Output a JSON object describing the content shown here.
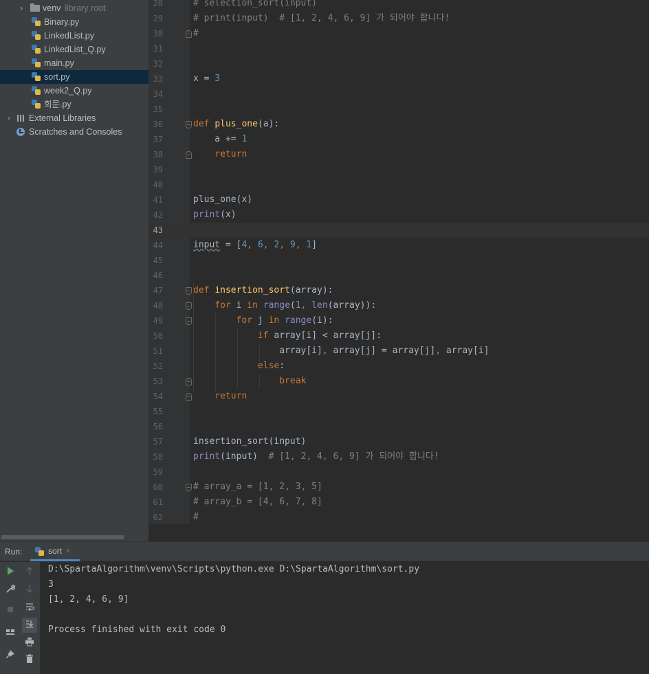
{
  "project_tree": {
    "items": [
      {
        "label": "venv",
        "hint": "library root",
        "icon": "folder-icon",
        "indent": 2,
        "expander": "›"
      },
      {
        "label": "Binary.py",
        "icon": "python-file-icon",
        "indent": 3
      },
      {
        "label": "LinkedList.py",
        "icon": "python-file-icon",
        "indent": 3
      },
      {
        "label": "LinkedList_Q.py",
        "icon": "python-file-icon",
        "indent": 3
      },
      {
        "label": "main.py",
        "icon": "python-file-icon",
        "indent": 3
      },
      {
        "label": "sort.py",
        "icon": "python-file-icon",
        "indent": 3,
        "selected": true
      },
      {
        "label": "week2_Q.py",
        "icon": "python-file-icon",
        "indent": 3
      },
      {
        "label": "회문.py",
        "icon": "python-file-icon",
        "indent": 3
      },
      {
        "label": "External Libraries",
        "icon": "library-icon",
        "indent": 1,
        "expander": "›"
      },
      {
        "label": "Scratches and Consoles",
        "icon": "scratch-icon",
        "indent": 1
      }
    ]
  },
  "editor": {
    "file": "sort.py",
    "current_line": 43,
    "lines": [
      {
        "n": "28",
        "text": "# selection_sort(input)"
      },
      {
        "n": "29",
        "text": "# print(input)  # [1, 2, 4, 6, 9] 가 되어야 합니다!"
      },
      {
        "n": "30",
        "text": "#"
      },
      {
        "n": "31",
        "text": ""
      },
      {
        "n": "32",
        "text": ""
      },
      {
        "n": "33",
        "text": "x = 3"
      },
      {
        "n": "34",
        "text": ""
      },
      {
        "n": "35",
        "text": ""
      },
      {
        "n": "36",
        "text": "def plus_one(a):"
      },
      {
        "n": "37",
        "text": "    a += 1"
      },
      {
        "n": "38",
        "text": "    return"
      },
      {
        "n": "39",
        "text": ""
      },
      {
        "n": "40",
        "text": ""
      },
      {
        "n": "41",
        "text": "plus_one(x)"
      },
      {
        "n": "42",
        "text": "print(x)"
      },
      {
        "n": "43",
        "text": ""
      },
      {
        "n": "44",
        "text": "input = [4, 6, 2, 9, 1]"
      },
      {
        "n": "45",
        "text": ""
      },
      {
        "n": "46",
        "text": ""
      },
      {
        "n": "47",
        "text": "def insertion_sort(array):"
      },
      {
        "n": "48",
        "text": "    for i in range(1, len(array)):"
      },
      {
        "n": "49",
        "text": "        for j in range(i):"
      },
      {
        "n": "50",
        "text": "            if array[i] < array[j]:"
      },
      {
        "n": "51",
        "text": "                array[i], array[j] = array[j], array[i]"
      },
      {
        "n": "52",
        "text": "            else:"
      },
      {
        "n": "53",
        "text": "                break"
      },
      {
        "n": "54",
        "text": "    return"
      },
      {
        "n": "55",
        "text": ""
      },
      {
        "n": "56",
        "text": ""
      },
      {
        "n": "57",
        "text": "insertion_sort(input)"
      },
      {
        "n": "58",
        "text": "print(input)  # [1, 2, 4, 6, 9] 가 되어야 합니다!"
      },
      {
        "n": "59",
        "text": ""
      },
      {
        "n": "60",
        "text": "# array_a = [1, 2, 3, 5]"
      },
      {
        "n": "61",
        "text": "# array_b = [4, 6, 7, 8]"
      },
      {
        "n": "62",
        "text": "#"
      }
    ]
  },
  "run": {
    "label": "Run:",
    "tab_label": "sort",
    "tab_close": "×",
    "console_lines": [
      "D:\\SpartaAlgorithm\\venv\\Scripts\\python.exe D:\\SpartaAlgorithm\\sort.py",
      "3",
      "[1, 2, 4, 6, 9]",
      "",
      "Process finished with exit code 0"
    ]
  },
  "colors": {
    "editor_bg": "#2b2b2b",
    "panel_bg": "#3c3f41",
    "keyword": "#cc7832",
    "function_name": "#ffc66d",
    "number": "#6897bb",
    "builtin": "#8888c6",
    "comment": "#808080",
    "selection": "#0d293e",
    "run_green": "#59a869"
  }
}
